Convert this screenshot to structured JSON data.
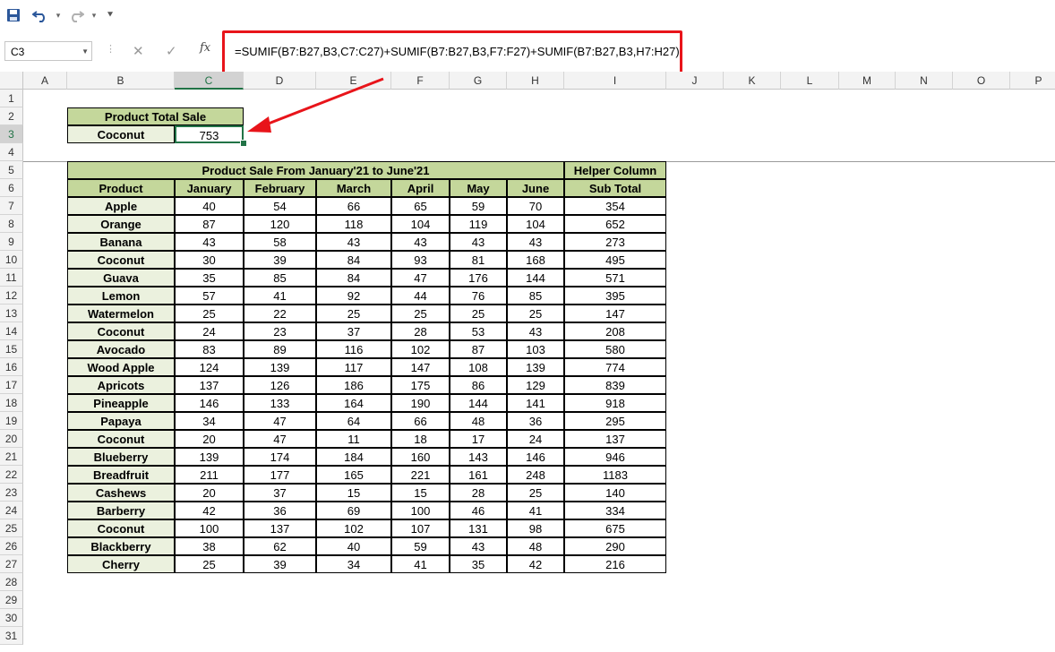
{
  "toolbar": {
    "save_icon": "save-icon",
    "undo_icon": "undo-icon",
    "redo_icon": "redo-icon",
    "customize_icon": "customize-qat-icon"
  },
  "formula_bar": {
    "name_box": "C3",
    "cancel_glyph": "✕",
    "enter_glyph": "✓",
    "fx_label": "fx",
    "formula": "=SUMIF(B7:B27,B3,C7:C27)+SUMIF(B7:B27,B3,F7:F27)+SUMIF(B7:B27,B3,H7:H27)"
  },
  "columns": [
    "A",
    "B",
    "C",
    "D",
    "E",
    "F",
    "G",
    "H",
    "I",
    "J",
    "K",
    "L",
    "M",
    "N",
    "O",
    "P"
  ],
  "rows": [
    "1",
    "2",
    "3",
    "4",
    "5",
    "6",
    "7",
    "8",
    "9",
    "10",
    "11",
    "12",
    "13",
    "14",
    "15",
    "16",
    "17",
    "18",
    "19",
    "20",
    "21",
    "22",
    "23",
    "24",
    "25",
    "26",
    "27",
    "28",
    "29",
    "30",
    "31"
  ],
  "lookup": {
    "title": "Product Total Sale",
    "label": "Coconut",
    "value": "753"
  },
  "table": {
    "title": "Product Sale From January'21 to June'21",
    "helper_title": "Helper Column",
    "headers": [
      "Product",
      "January",
      "February",
      "March",
      "April",
      "May",
      "June",
      "Sub Total"
    ],
    "rows": [
      [
        "Apple",
        "40",
        "54",
        "66",
        "65",
        "59",
        "70",
        "354"
      ],
      [
        "Orange",
        "87",
        "120",
        "118",
        "104",
        "119",
        "104",
        "652"
      ],
      [
        "Banana",
        "43",
        "58",
        "43",
        "43",
        "43",
        "43",
        "273"
      ],
      [
        "Coconut",
        "30",
        "39",
        "84",
        "93",
        "81",
        "168",
        "495"
      ],
      [
        "Guava",
        "35",
        "85",
        "84",
        "47",
        "176",
        "144",
        "571"
      ],
      [
        "Lemon",
        "57",
        "41",
        "92",
        "44",
        "76",
        "85",
        "395"
      ],
      [
        "Watermelon",
        "25",
        "22",
        "25",
        "25",
        "25",
        "25",
        "147"
      ],
      [
        "Coconut",
        "24",
        "23",
        "37",
        "28",
        "53",
        "43",
        "208"
      ],
      [
        "Avocado",
        "83",
        "89",
        "116",
        "102",
        "87",
        "103",
        "580"
      ],
      [
        "Wood Apple",
        "124",
        "139",
        "117",
        "147",
        "108",
        "139",
        "774"
      ],
      [
        "Apricots",
        "137",
        "126",
        "186",
        "175",
        "86",
        "129",
        "839"
      ],
      [
        "Pineapple",
        "146",
        "133",
        "164",
        "190",
        "144",
        "141",
        "918"
      ],
      [
        "Papaya",
        "34",
        "47",
        "64",
        "66",
        "48",
        "36",
        "295"
      ],
      [
        "Coconut",
        "20",
        "47",
        "11",
        "18",
        "17",
        "24",
        "137"
      ],
      [
        "Blueberry",
        "139",
        "174",
        "184",
        "160",
        "143",
        "146",
        "946"
      ],
      [
        "Breadfruit",
        "211",
        "177",
        "165",
        "221",
        "161",
        "248",
        "1183"
      ],
      [
        "Cashews",
        "20",
        "37",
        "15",
        "15",
        "28",
        "25",
        "140"
      ],
      [
        "Barberry",
        "42",
        "36",
        "69",
        "100",
        "46",
        "41",
        "334"
      ],
      [
        "Coconut",
        "100",
        "137",
        "102",
        "107",
        "131",
        "98",
        "675"
      ],
      [
        "Blackberry",
        "38",
        "62",
        "40",
        "59",
        "43",
        "48",
        "290"
      ],
      [
        "Cherry",
        "25",
        "39",
        "34",
        "41",
        "35",
        "42",
        "216"
      ]
    ]
  },
  "colors": {
    "header_fill": "#c4d79b",
    "product_fill": "#ebf1de",
    "selection": "#217346",
    "annotation": "#e8141a"
  }
}
